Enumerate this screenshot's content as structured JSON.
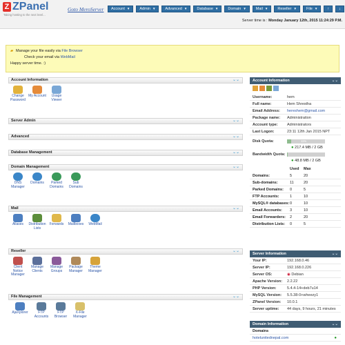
{
  "app": {
    "logo": "ZPanel",
    "logo_mark": "Z",
    "tagline": "Taking hosting to the next level...",
    "server_link": "Goto MeroServer"
  },
  "nav": [
    "Account",
    "Admin",
    "Advanced",
    "Database",
    "Domain",
    "Mail",
    "Reseller",
    "File"
  ],
  "nav_icons": {
    "arrow_up": "↑",
    "arrow_down": "↓"
  },
  "server_time": {
    "label": "Server time is :",
    "value": "Monday January 12th, 2015 11:24:29 P.M."
  },
  "notice": {
    "line1_prefix": "Manage your file easily via ",
    "line1_link": "File Browser",
    "line2_prefix": "Check your email via ",
    "line2_link": "WebMail",
    "line3": "Happy server time. :)"
  },
  "left_panels": {
    "account_info": {
      "title": "Account Information",
      "icons": [
        "Change Password",
        "My Account",
        "Usage Viewer"
      ]
    },
    "server_admin": {
      "title": "Server Admin"
    },
    "advanced": {
      "title": "Advanced"
    },
    "database": {
      "title": "Database Management"
    },
    "domain": {
      "title": "Domain Management",
      "icons": [
        "DNS Manager",
        "Domains",
        "Parked Domains",
        "Sub Domains"
      ]
    },
    "mail": {
      "title": "Mail",
      "icons": [
        "Aliases",
        "Distribution Lists",
        "Forwards",
        "Mailboxes",
        "WebMail"
      ]
    },
    "reseller": {
      "title": "Reseller",
      "icons": [
        "Client Notice Manager",
        "Manage Clients",
        "Manage Groups",
        "Package Manager",
        "Theme Manager"
      ]
    },
    "file": {
      "title": "File Management",
      "icons": [
        "AjaXplorer",
        "FTP Accounts",
        "FTP Browser",
        "X-File Manager"
      ]
    }
  },
  "account_panel": {
    "title": "Account Information",
    "rows": [
      {
        "k": "Username:",
        "v": "hem"
      },
      {
        "k": "Full name:",
        "v": "Hem Shrestha"
      },
      {
        "k": "Email Address:",
        "v": "hereshem@gmail.com"
      },
      {
        "k": "Package name:",
        "v": "Administration"
      },
      {
        "k": "Account type:",
        "v": "Administrators"
      },
      {
        "k": "Last Logon:",
        "v": "23:11 12th Jan 2015 NPT"
      }
    ],
    "disk_quota": {
      "label": "Disk Quota:",
      "bar_text": "11%",
      "fill": 0.11,
      "value": "217.4 MB / 2 GB"
    },
    "bandwidth_quota": {
      "label": "Bandwidth Quota:",
      "fill": 0.02,
      "value": "48.8 MB / 2 GB"
    },
    "usage_headers": {
      "used": "Used",
      "max": "Max"
    },
    "usage": [
      {
        "k": "Domains:",
        "u": "5",
        "m": "20"
      },
      {
        "k": "Sub-domains:",
        "u": "11",
        "m": "20"
      },
      {
        "k": "Parked Domains:",
        "u": "0",
        "m": "5"
      },
      {
        "k": "FTP Accounts:",
        "u": "1",
        "m": "10"
      },
      {
        "k": "MySQL® databases:",
        "u": "0",
        "m": "10"
      },
      {
        "k": "Email Accounts:",
        "u": "3",
        "m": "10"
      },
      {
        "k": "Email Forwarders:",
        "u": "2",
        "m": "20"
      },
      {
        "k": "Distribution Lists:",
        "u": "0",
        "m": "5"
      }
    ]
  },
  "server_panel": {
    "title": "Server Information",
    "rows": [
      {
        "k": "Your IP:",
        "v": "192.168.0.46"
      },
      {
        "k": "Server IP:",
        "v": "192.168.0.226"
      },
      {
        "k": "Server OS:",
        "v": "Debian"
      },
      {
        "k": "Apache Version:",
        "v": "2.2.22"
      },
      {
        "k": "PHP Version:",
        "v": "5.4.4-14+deb7u14"
      },
      {
        "k": "MySQL Version:",
        "v": "5.5.38-0+wheezy1"
      },
      {
        "k": "ZPanel Version:",
        "v": "10.0.1"
      },
      {
        "k": "Server uptime:",
        "v": "44 days, 9 hours, 21 minutes"
      }
    ]
  },
  "domain_panel": {
    "title": "Domain Information",
    "sub": "Domains",
    "first": "hotelunitednepal.com"
  },
  "colors": {
    "nav_blue": "#2f6ea3",
    "panel_dark": "#3f5c73",
    "notice_bg": "#fdfbb8",
    "link": "#2b55a6"
  }
}
